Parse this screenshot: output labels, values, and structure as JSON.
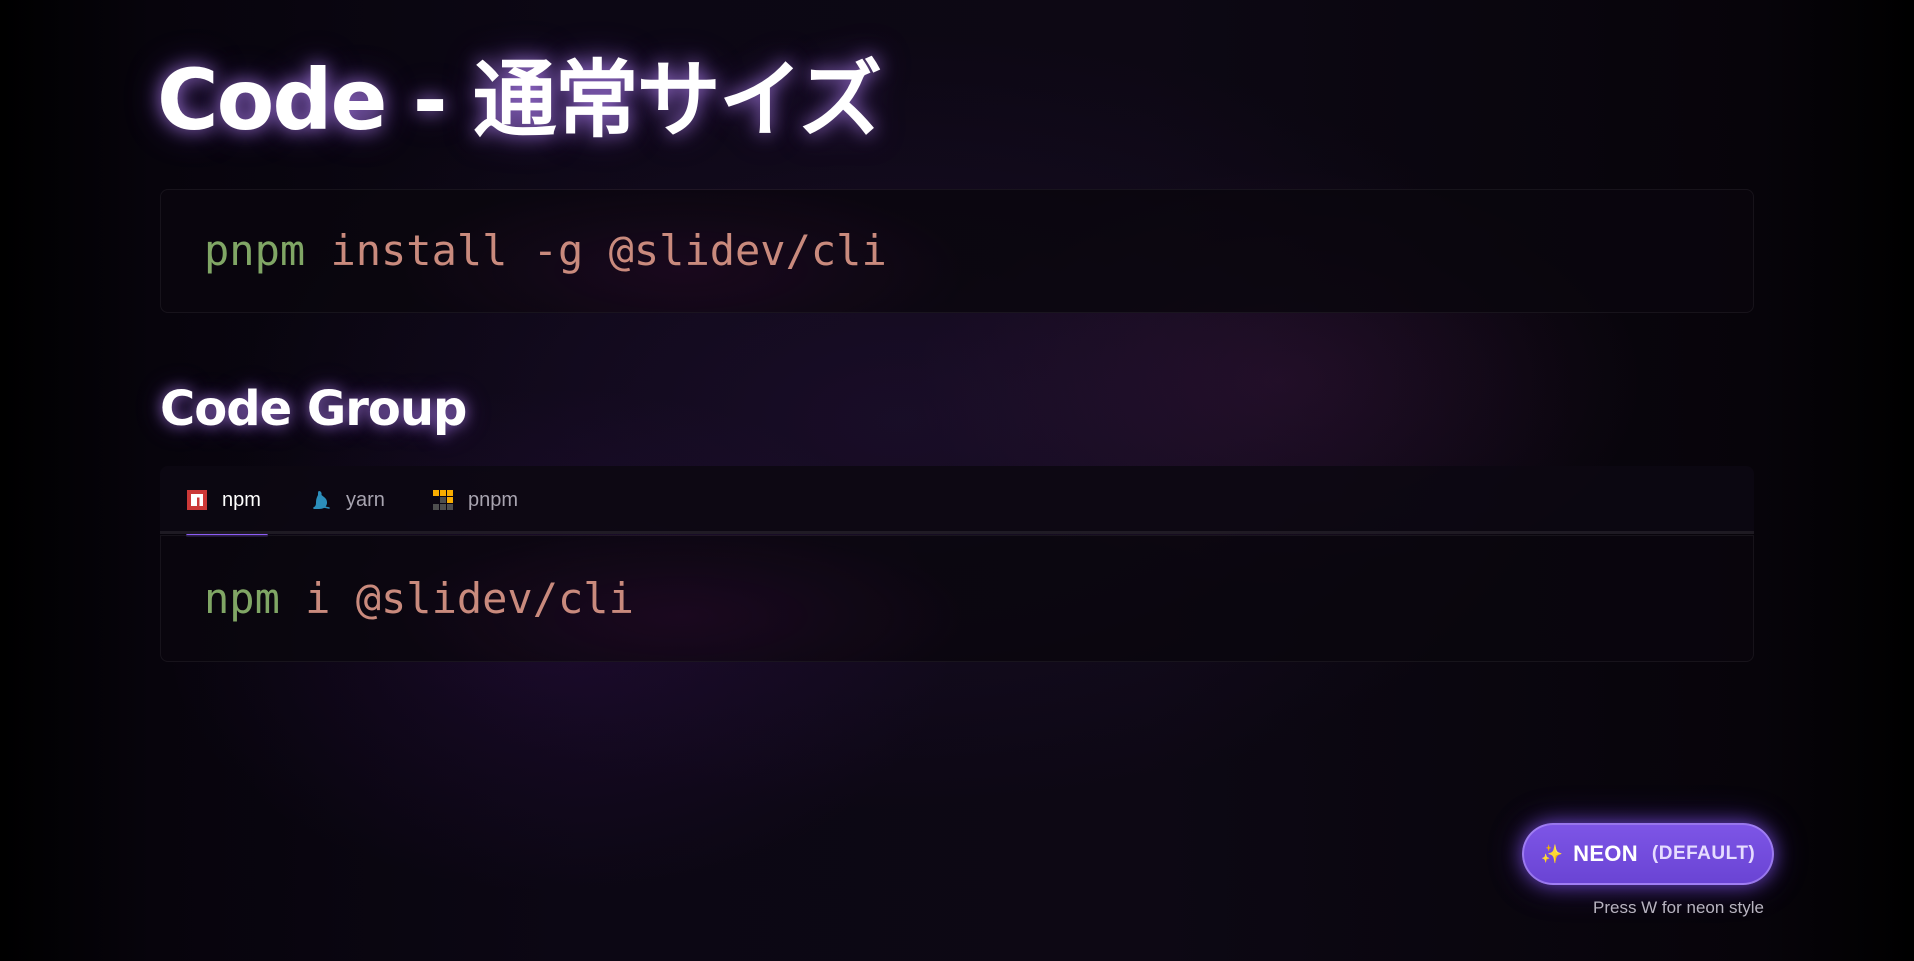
{
  "title": "Code - 通常サイズ",
  "code_block": {
    "command": "pnpm",
    "args": " install -g @slidev/cli"
  },
  "code_group": {
    "heading": "Code Group",
    "tabs": [
      {
        "label": "npm",
        "icon": "npm-icon",
        "active": true
      },
      {
        "label": "yarn",
        "icon": "yarn-icon",
        "active": false
      },
      {
        "label": "pnpm",
        "icon": "pnpm-icon",
        "active": false
      }
    ],
    "command": "npm",
    "args": " i @slidev/cli"
  },
  "theme_toggle": {
    "icon": "✨",
    "label": "NEON",
    "mode": "(DEFAULT)",
    "hint": "Press W for neon style"
  },
  "colors": {
    "accent": "#8b5cf6",
    "command": "#80a665",
    "argument": "#c98a7d",
    "npm": "#cb3837",
    "yarn": "#2c8ebb",
    "pnpm": "#f9ad00"
  }
}
